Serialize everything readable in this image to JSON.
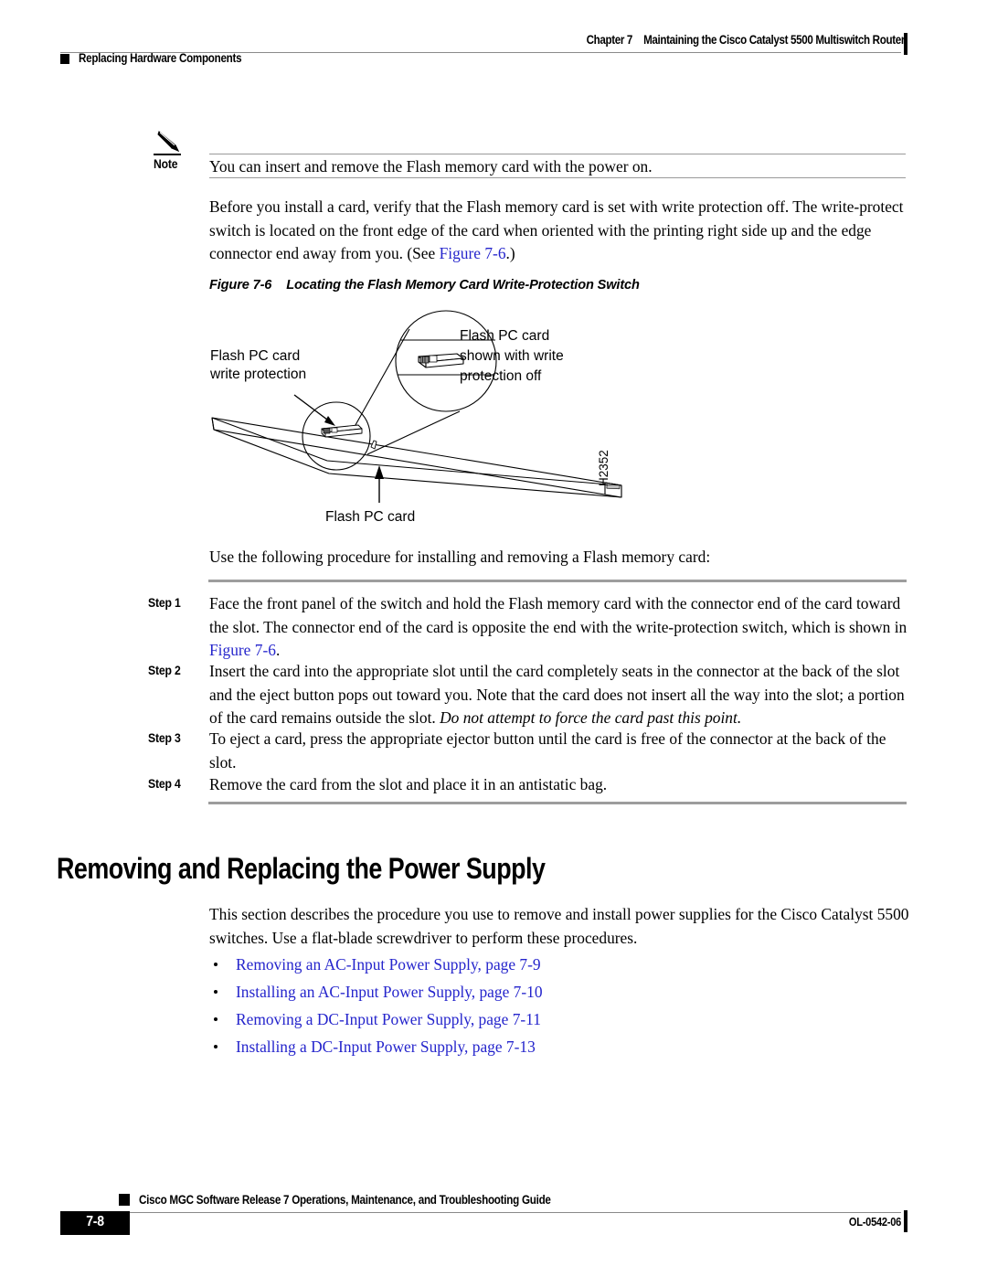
{
  "header": {
    "chapter_label": "Chapter 7",
    "chapter_title": "Maintaining the Cisco Catalyst 5500 Multiswitch Router",
    "section_title": "Replacing Hardware Components"
  },
  "note": {
    "label": "Note",
    "text": "You can insert and remove the Flash memory card with the power on."
  },
  "paragraphs": {
    "intro_1": "Before you install a card, verify that the Flash memory card is set with write protection off. The write-protect switch is located on the front edge of the card when oriented with the printing right side up and the edge connector end away from you. (See ",
    "intro_link": "Figure 7-6",
    "intro_2": ".)",
    "use_following": "Use the following procedure for installing and removing a Flash memory card:",
    "section_desc": "This section describes the procedure you use to remove and install power supplies for the Cisco Catalyst 5500 switches. Use a flat-blade screwdriver to perform these procedures."
  },
  "figure": {
    "caption_number": "Figure 7-6",
    "caption_title": "Locating the Flash Memory Card Write-Protection Switch",
    "label_left_line1": "Flash PC card",
    "label_left_line2": "write protection",
    "label_right_line1": "Flash PC card",
    "label_right_line2": "shown with write",
    "label_right_line3": "protection off",
    "label_bottom": "Flash PC card",
    "art_id": "H2352"
  },
  "steps": [
    {
      "label": "Step 1",
      "text_before": "Face the front panel of the switch and hold the Flash memory card with the connector end of the card toward the slot. The connector end of the card is opposite the end with the write-protection switch, which is shown in ",
      "link": "Figure 7-6",
      "text_after": "."
    },
    {
      "label": "Step 2",
      "text_before": "Insert the card into the appropriate slot until the card completely seats in the connector at the back of the slot and the eject button pops out toward you. Note that the card does not insert all the way into the slot; a portion of the card remains outside the slot. ",
      "italic": "Do not attempt to force the card past this point.",
      "text_after": ""
    },
    {
      "label": "Step 3",
      "text_before": "To eject a card, press the appropriate ejector button until the card is free of the connector at the back of the slot.",
      "link": "",
      "text_after": ""
    },
    {
      "label": "Step 4",
      "text_before": "Remove the card from the slot and place it in an antistatic bag.",
      "link": "",
      "text_after": ""
    }
  ],
  "section_heading": "Removing and Replacing the Power Supply",
  "bullets": [
    "Removing an AC-Input Power Supply, page 7-9",
    "Installing an AC-Input Power Supply, page 7-10",
    "Removing a DC-Input Power Supply, page 7-11",
    "Installing a DC-Input Power Supply, page 7-13"
  ],
  "footer": {
    "guide_title": "Cisco MGC Software Release 7 Operations, Maintenance, and Troubleshooting Guide",
    "page_number": "7-8",
    "doc_id": "OL-0542-06"
  },
  "colors": {
    "link": "#2525cc",
    "rule": "#9a9a9a",
    "text": "#000000"
  }
}
